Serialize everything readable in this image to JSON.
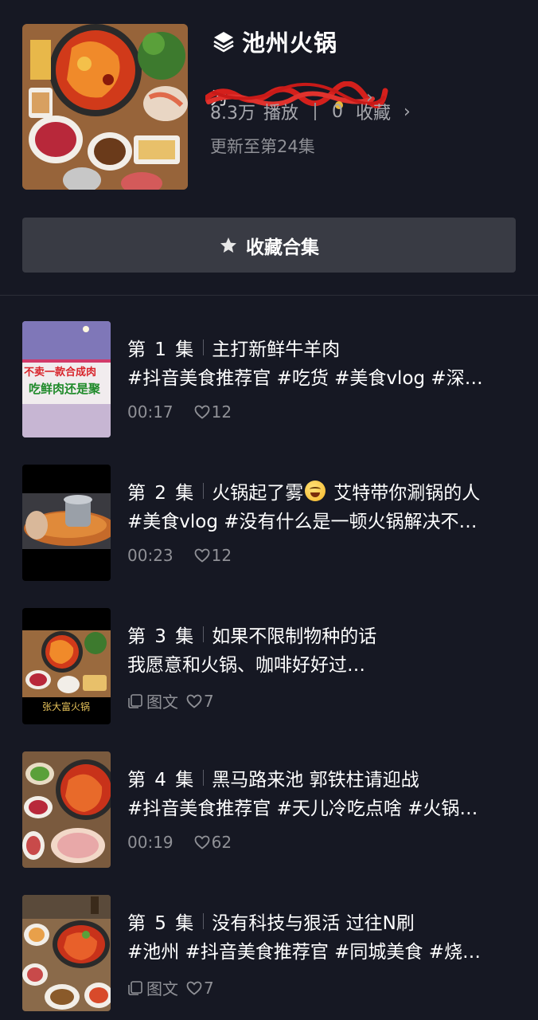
{
  "collection": {
    "title": "池州火锅",
    "author": "为",
    "plays": "8.3万",
    "plays_label": "播放",
    "favorites": "0",
    "favorites_label": "收藏",
    "update": "更新至第24集"
  },
  "collect_button": {
    "label": "收藏合集"
  },
  "episodes": [
    {
      "ep": "第 1 集",
      "title": "主打新鲜牛羊肉",
      "desc": "#抖音美食推荐官 #吃货 #美食vlog #深…",
      "duration": "00:17",
      "likes": "12",
      "type": "video"
    },
    {
      "ep": "第 2 集",
      "title": "火锅起了雾",
      "title_after": "艾特带你涮锅的人",
      "desc": "#美食vlog #没有什么是一顿火锅解决不…",
      "duration": "00:23",
      "likes": "12",
      "type": "video"
    },
    {
      "ep": "第 3 集",
      "title": "如果不限制物种的话",
      "desc": "我愿意和火锅、咖啡好好过…",
      "tag": "图文",
      "likes": "7",
      "type": "note"
    },
    {
      "ep": "第 4 集",
      "title": "黑马路来池 郭铁柱请迎战",
      "desc": "#抖音美食推荐官 #天儿冷吃点啥 #火锅…",
      "duration": "00:19",
      "likes": "62",
      "type": "video"
    },
    {
      "ep": "第 5 集",
      "title": "没有科技与狠活 过往N刷",
      "desc": "#池州 #抖音美食推荐官 #同城美食 #烧…",
      "tag": "图文",
      "likes": "7",
      "type": "note"
    }
  ],
  "thumb_texts": {
    "ep1_line1": "不卖一款合成肉",
    "ep1_line2": "吃鲜肉还是聚",
    "ep3_caption": "张大富火锅"
  },
  "colors": {
    "background": "#161823",
    "button": "#393b44",
    "muted": "#8f9096",
    "accent_red": "#e0322d"
  }
}
